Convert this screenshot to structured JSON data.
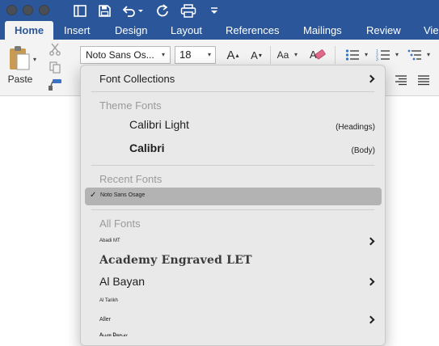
{
  "title_bar": {
    "traffic_lights": [
      "close",
      "minimize",
      "zoom"
    ],
    "quick_access_icons": [
      "sidebar-icon",
      "save-icon",
      "undo-icon",
      "redo-icon",
      "print-icon",
      "customize-icon"
    ]
  },
  "tabs": [
    {
      "label": "Home",
      "active": true
    },
    {
      "label": "Insert",
      "active": false
    },
    {
      "label": "Design",
      "active": false
    },
    {
      "label": "Layout",
      "active": false
    },
    {
      "label": "References",
      "active": false
    },
    {
      "label": "Mailings",
      "active": false
    },
    {
      "label": "Review",
      "active": false
    },
    {
      "label": "Vie",
      "active": false
    }
  ],
  "ribbon": {
    "paste_label": "Paste",
    "font_name": "Noto Sans Os...",
    "font_size": "18"
  },
  "dropdown": {
    "font_collections": "Font Collections",
    "theme_header": "Theme Fonts",
    "theme_fonts": [
      {
        "name": "Calibri Light",
        "hint": "(Headings)"
      },
      {
        "name": "Calibri",
        "hint": "(Body)"
      }
    ],
    "recent_header": "Recent Fonts",
    "recent_fonts": [
      {
        "name": "Noto Sans Osage",
        "checked": true,
        "check": "✓"
      }
    ],
    "all_header": "All Fonts",
    "all_fonts": [
      {
        "name": "Abadi MT",
        "has_submenu": true
      },
      {
        "name": "Academy Engraved LET",
        "has_submenu": false
      },
      {
        "name": "Al Bayan",
        "has_submenu": true
      },
      {
        "name": "Al Tarikh",
        "has_submenu": false
      },
      {
        "name": "Aller",
        "has_submenu": true
      },
      {
        "name": "Aller Display",
        "has_submenu": false
      }
    ]
  },
  "colors": {
    "word_blue": "#2b579a",
    "ribbon_bg": "#f3f3f3",
    "menu_bg": "#e9e9e9",
    "highlight": "#b3b3b3"
  }
}
